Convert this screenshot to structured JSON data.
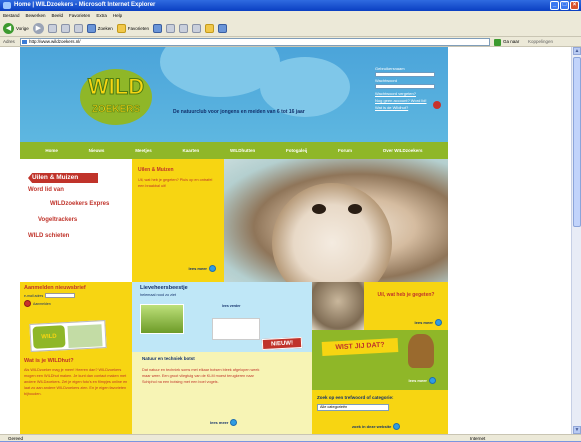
{
  "window": {
    "title": "Home | WILDzoekers - Microsoft Internet Explorer",
    "minimize": "_",
    "maximize": "□",
    "close": "×"
  },
  "menu": [
    "Bestand",
    "Bewerken",
    "Beeld",
    "Favorieten",
    "Extra",
    "Help"
  ],
  "toolbar": {
    "back": "Vorige",
    "search": "Zoeken",
    "favorites": "Favorieten"
  },
  "address": {
    "label": "Adres",
    "url": "http://www.wildzoekers.nl/",
    "go": "Ga naar",
    "links": "Koppelingen"
  },
  "site": {
    "logo_top": "WILD",
    "logo_bottom": "ZOEKERS",
    "slogan": "De natuurclub voor jongens en meiden van 6 tot 16 jaar",
    "login": {
      "username_label": "Gebruikersnaam",
      "password_label": "Wachtwoord",
      "forgot": "Wachtwoord vergeten?",
      "no_account": "Nog geen account? Word lid!",
      "what": "Wat is de Wildhut?"
    },
    "nav": [
      "Home",
      "Nieuws",
      "Meetjes",
      "Kaarten",
      "WILDhutten",
      "Fotogaleij",
      "Forum",
      "Over WILDzoekers"
    ],
    "left_menu": {
      "active": "Uilen & Muizen",
      "items": [
        "Word lid van",
        "WILDzoekers Expres",
        "Vogeltrackers",
        "WILD schieten"
      ]
    },
    "promo": {
      "title": "Uilen & Muizen",
      "text": "Uil, wat heb je gegeten? Pluis op en ontrafel een braakbal uit!",
      "more": "lees meer"
    },
    "newsletter": {
      "title": "Aanmelden nieuwsbrief",
      "email_label": "e-mail adres",
      "subscribe": "Aanmelden",
      "card_logo": "WILD"
    },
    "whatis": {
      "title": "Wat is je WILDhut?",
      "text": "Als WILDzoeker mag je meer! Heeren dan? WILDzoekers mogen een WILDhut maken. Je kunt dan contact maken met andere WILDzoekers. Zet je eigen foto's en filmpjes online en laat zo aan andere WILDzoekers zien. En je eigen favorieten bijhouden."
    },
    "beestje": {
      "title": "Lieveheersbeestje",
      "subtitle": "helemaal rood zo ziet",
      "more_tag": "lees verder",
      "new_badge": "NIEUW!"
    },
    "nature": {
      "title": "Natuur en techniek botst",
      "text": "Dat natuur en techniek soms met elkaar botsen bleek afgelopen week maar weer. Een groot vliegtuig van de KLM moest terugkeren naar Schiphol na een botsing met een boel vogels.",
      "more": "lees meer"
    },
    "right": {
      "question": "Uil, wat heb je gegeten?",
      "more": "lees meer",
      "banner": "WIST JIJ DAT?",
      "wist_more": "lees meer",
      "search_title": "Zoek op een trefwoord of categorie:",
      "select": "Alle categorieën",
      "search_btn": "zoek in deze website"
    }
  },
  "status": {
    "left": "Gereed",
    "zone": "Internet"
  }
}
